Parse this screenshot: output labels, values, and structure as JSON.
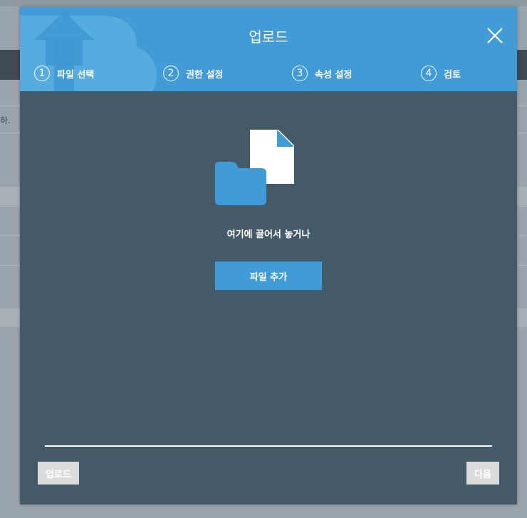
{
  "background": {
    "fragment_text": "하."
  },
  "dialog": {
    "title": "업로드",
    "close_icon": "close-icon",
    "steps": [
      {
        "number": "1",
        "label": "파일 선택",
        "active": true
      },
      {
        "number": "2",
        "label": "권한 설정",
        "active": false
      },
      {
        "number": "3",
        "label": "속성 설정",
        "active": false
      },
      {
        "number": "4",
        "label": "검토",
        "active": false
      }
    ],
    "drop_zone": {
      "icon": "file-folder-icon",
      "text": "여기에 끌어서 놓거나",
      "add_button_label": "파일 추가"
    },
    "footer": {
      "upload_label": "업로드",
      "next_label": "다음"
    }
  },
  "colors": {
    "accent": "#419bd6",
    "dialog_body": "#455a69",
    "disabled_button": "#dcdcdc"
  }
}
